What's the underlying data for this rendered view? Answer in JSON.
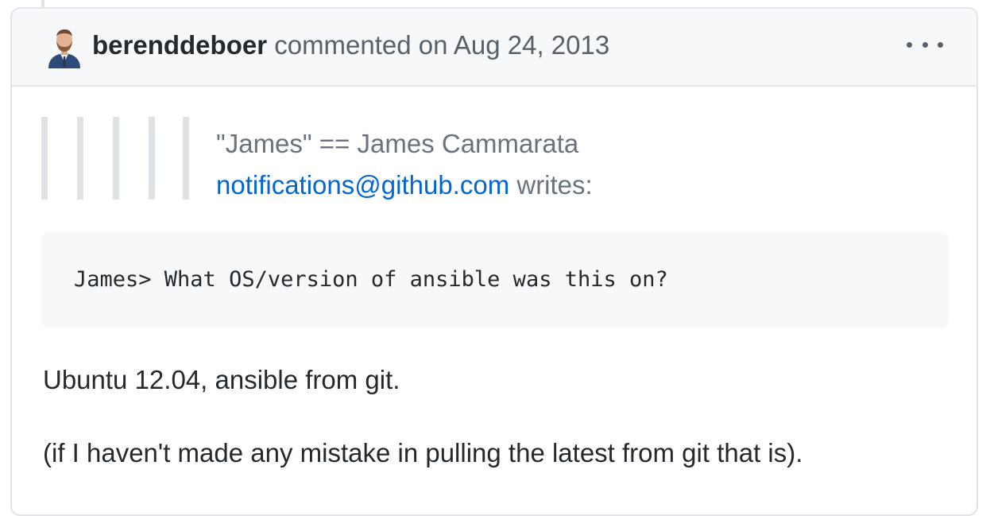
{
  "comment": {
    "author": "berenddeboer",
    "action": "commented on",
    "date": "Aug 24, 2013",
    "more_icon": "kebab-horizontal-icon",
    "avatar_icon": "user-avatar",
    "quote": {
      "line1": "\"James\" == James Cammarata",
      "email": "notifications@github.com",
      "writes": "writes:"
    },
    "code": "James> What OS/version of ansible was this on?",
    "paragraphs": [
      "Ubuntu 12.04, ansible from git.",
      "(if I haven't made any mistake in pulling the latest from git that is)."
    ]
  },
  "colors": {
    "link": "#0366d6",
    "text": "#24292e",
    "muted": "#586069",
    "header_bg": "#f6f8fa",
    "border": "#e1e4e8"
  }
}
